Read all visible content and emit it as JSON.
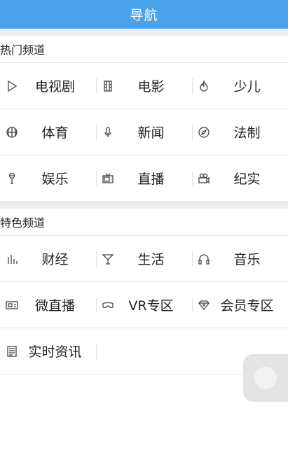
{
  "header": {
    "title": "导航"
  },
  "hot": {
    "title": "热门频道",
    "rows": [
      [
        {
          "label": "电视剧",
          "icon": "play-icon"
        },
        {
          "label": "电影",
          "icon": "film-icon"
        },
        {
          "label": "少儿",
          "icon": "flame-icon"
        }
      ],
      [
        {
          "label": "体育",
          "icon": "ball-icon"
        },
        {
          "label": "新闻",
          "icon": "microphone-icon"
        },
        {
          "label": "法制",
          "icon": "compass-icon"
        }
      ],
      [
        {
          "label": "娱乐",
          "icon": "mic-stand-icon"
        },
        {
          "label": "直播",
          "icon": "tv-icon"
        },
        {
          "label": "纪实",
          "icon": "camera-icon"
        }
      ]
    ]
  },
  "special": {
    "title": "特色频道",
    "rows": [
      [
        {
          "label": "财经",
          "icon": "bar-chart-icon"
        },
        {
          "label": "生活",
          "icon": "cocktail-icon"
        },
        {
          "label": "音乐",
          "icon": "headphones-icon"
        }
      ],
      [
        {
          "label": "微直播",
          "icon": "live-screen-icon"
        },
        {
          "label": "VR专区",
          "icon": "vr-icon"
        },
        {
          "label": "会员专区",
          "icon": "diamond-icon"
        }
      ],
      [
        {
          "label": "实时资讯",
          "icon": "newspaper-icon"
        }
      ]
    ]
  }
}
